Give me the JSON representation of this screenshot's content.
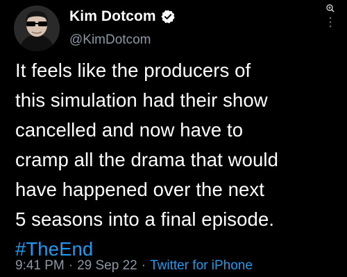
{
  "author": {
    "display_name": "Kim Dotcom",
    "handle": "@KimDotcom",
    "verified": true,
    "avatar_icon": "profile-avatar-sunglasses"
  },
  "tweet": {
    "lines": [
      "It feels like the producers of",
      "this simulation had their show",
      "cancelled and now have to",
      "cramp all the drama that would",
      "have happened over the next",
      "5 seasons into a final episode."
    ],
    "hashtag": "#TheEnd"
  },
  "meta": {
    "time": "9:41 PM",
    "separator": "·",
    "date": "29 Sep 22",
    "source": "Twitter for iPhone"
  },
  "colors": {
    "background": "#000000",
    "text": "#ffffff",
    "muted": "#8b98a5",
    "accent": "#1d9bf0"
  },
  "icons": {
    "verified": "verified-badge-icon",
    "zoom": "zoom-icon",
    "more": "more-vertical-icon"
  }
}
